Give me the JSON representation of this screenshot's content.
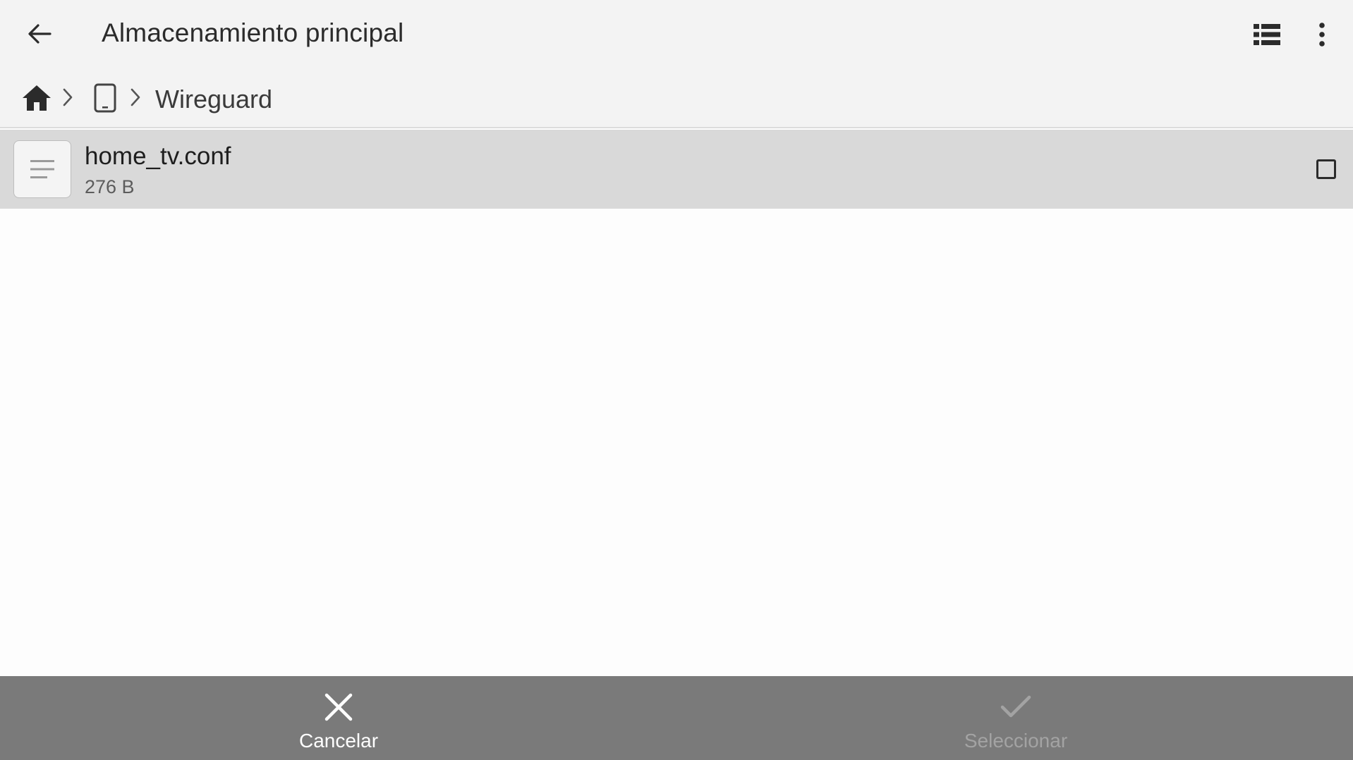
{
  "app": {
    "title": "Almacenamiento principal"
  },
  "toolbar": {
    "back_icon": "arrow-left-icon",
    "view_toggle_icon": "list-view-icon",
    "overflow_icon": "more-vert-icon"
  },
  "breadcrumb": {
    "home_icon": "home-icon",
    "device_icon": "phone-icon",
    "separator_icon": "chevron-right-icon",
    "folder": "Wireguard"
  },
  "files": [
    {
      "name": "home_tv.conf",
      "size": "276 B",
      "icon": "text-file-icon",
      "checked": false
    }
  ],
  "actions": {
    "cancel_label": "Cancelar",
    "cancel_icon": "close-icon",
    "select_label": "Seleccionar",
    "select_icon": "check-icon"
  },
  "colors": {
    "bar_bg": "#f3f3f3",
    "row_selected_bg": "#d9d9d9",
    "bottom_bar_bg": "#7a7a7a",
    "disabled_text": "#a3a3a3"
  }
}
